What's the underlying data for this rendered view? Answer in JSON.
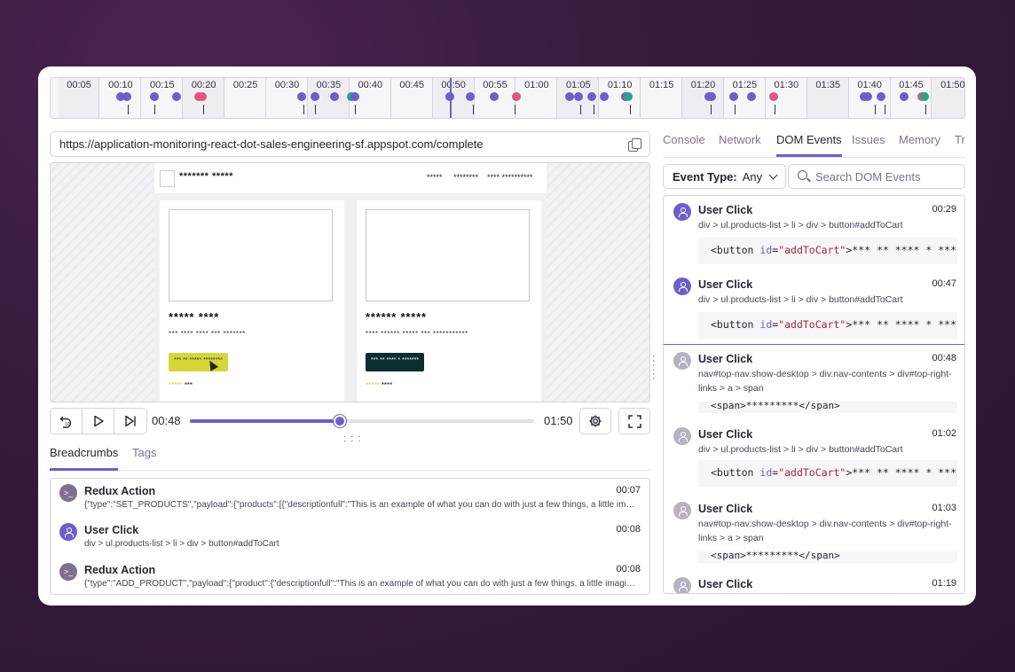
{
  "timeline": {
    "labels": [
      "00:05",
      "00:10",
      "00:15",
      "00:20",
      "00:25",
      "00:30",
      "00:35",
      "00:40",
      "00:45",
      "00:50",
      "00:55",
      "01:00",
      "01:05",
      "01:10",
      "01:15",
      "01:20",
      "01:25",
      "01:30",
      "01:35",
      "01:40",
      "01:45",
      "01:50"
    ],
    "current_time_label": "00:48"
  },
  "url": {
    "value": "https://application-monitoring-react-dot-sales-engineering-sf.appspot.com/complete"
  },
  "replay": {
    "brand": "******* *****",
    "nav": [
      "*****",
      "********",
      "**** **********"
    ],
    "products": [
      {
        "title": "***** ****",
        "desc": "*** **** **** *** *******",
        "button": "*** ** ***** ********",
        "stars": "*****",
        "price": "***"
      },
      {
        "title": "****** *****",
        "desc": "**** ****** ***** *** ***********",
        "button": "*** ** **** * *******",
        "stars": "*****",
        "price": "****"
      }
    ]
  },
  "player": {
    "current": "00:48",
    "duration": "01:50",
    "progress": 0.436,
    "icons": [
      "rewind-10-icon",
      "play-icon",
      "skip-forward-icon",
      "gear-icon",
      "fullscreen-icon"
    ]
  },
  "bottom_tabs": [
    {
      "label": "Breadcrumbs",
      "active": true
    },
    {
      "label": "Tags",
      "active": false
    }
  ],
  "breadcrumbs": [
    {
      "type": "redux",
      "title": "Redux Action",
      "time": "00:07",
      "desc": "{\"type\":\"SET_PRODUCTS\",\"payload\":{\"products\":[{\"descriptionfull\":\"This is an example of what you can do with just a few things, a little imagination and a happy dream in your heart..."
    },
    {
      "type": "user",
      "title": "User Click",
      "time": "00:08",
      "desc": "div > ul.products-list > li > div > button#addToCart"
    },
    {
      "type": "redux",
      "title": "Redux Action",
      "time": "00:08",
      "desc": "{\"type\":\"ADD_PRODUCT\",\"payload\":{\"product\":{\"descriptionfull\":\"This is an example of what you can do with just a few things, a little imagination and a happy dream..."
    }
  ],
  "right_tabs": [
    {
      "label": "Console",
      "active": false
    },
    {
      "label": "Network",
      "active": false
    },
    {
      "label": "DOM Events",
      "active": true
    },
    {
      "label": "Issues",
      "active": false
    },
    {
      "label": "Memory",
      "active": false
    },
    {
      "label": "Trace",
      "active": false
    }
  ],
  "filter": {
    "label": "Event Type:",
    "value": "Any"
  },
  "search": {
    "placeholder": "Search DOM Events"
  },
  "dom_events": [
    {
      "title": "User Click",
      "time": "00:29",
      "selector": "div > ul.products-list > li > div > button#addToCart",
      "code_attr": "id",
      "code_val": "\"addToCart\"",
      "code_text": "*** ** **** * *******</button>",
      "state": "past"
    },
    {
      "title": "User Click",
      "time": "00:47",
      "selector": "div > ul.products-list > li > div > button#addToCart",
      "code_attr": "id",
      "code_val": "\"addToCart\"",
      "code_text": "*** ** **** * *******</button>",
      "state": "past"
    },
    {
      "title": "User Click",
      "time": "00:48",
      "selector": "nav#top-nav.show-desktop > div.nav-contents > div#top-right-links > a > span",
      "code_span": "<span>*********</span>",
      "state": "future"
    },
    {
      "title": "User Click",
      "time": "01:02",
      "selector": "div > ul.products-list > li > div > button#addToCart",
      "code_attr": "id",
      "code_val": "\"addToCart\"",
      "code_text": "*** ** **** * *******</button>",
      "state": "future"
    },
    {
      "title": "User Click",
      "time": "01:03",
      "selector": "nav#top-nav.show-desktop > div.nav-contents > div#top-right-links > a > span",
      "code_span": "<span>*********</span>",
      "state": "future"
    },
    {
      "title": "User Click",
      "time": "01:19",
      "selector": "",
      "state": "future"
    }
  ],
  "colors": {
    "accent": "#6c5fc7",
    "error": "#e1567c",
    "success": "#2ba185",
    "muted": "#80708f"
  }
}
